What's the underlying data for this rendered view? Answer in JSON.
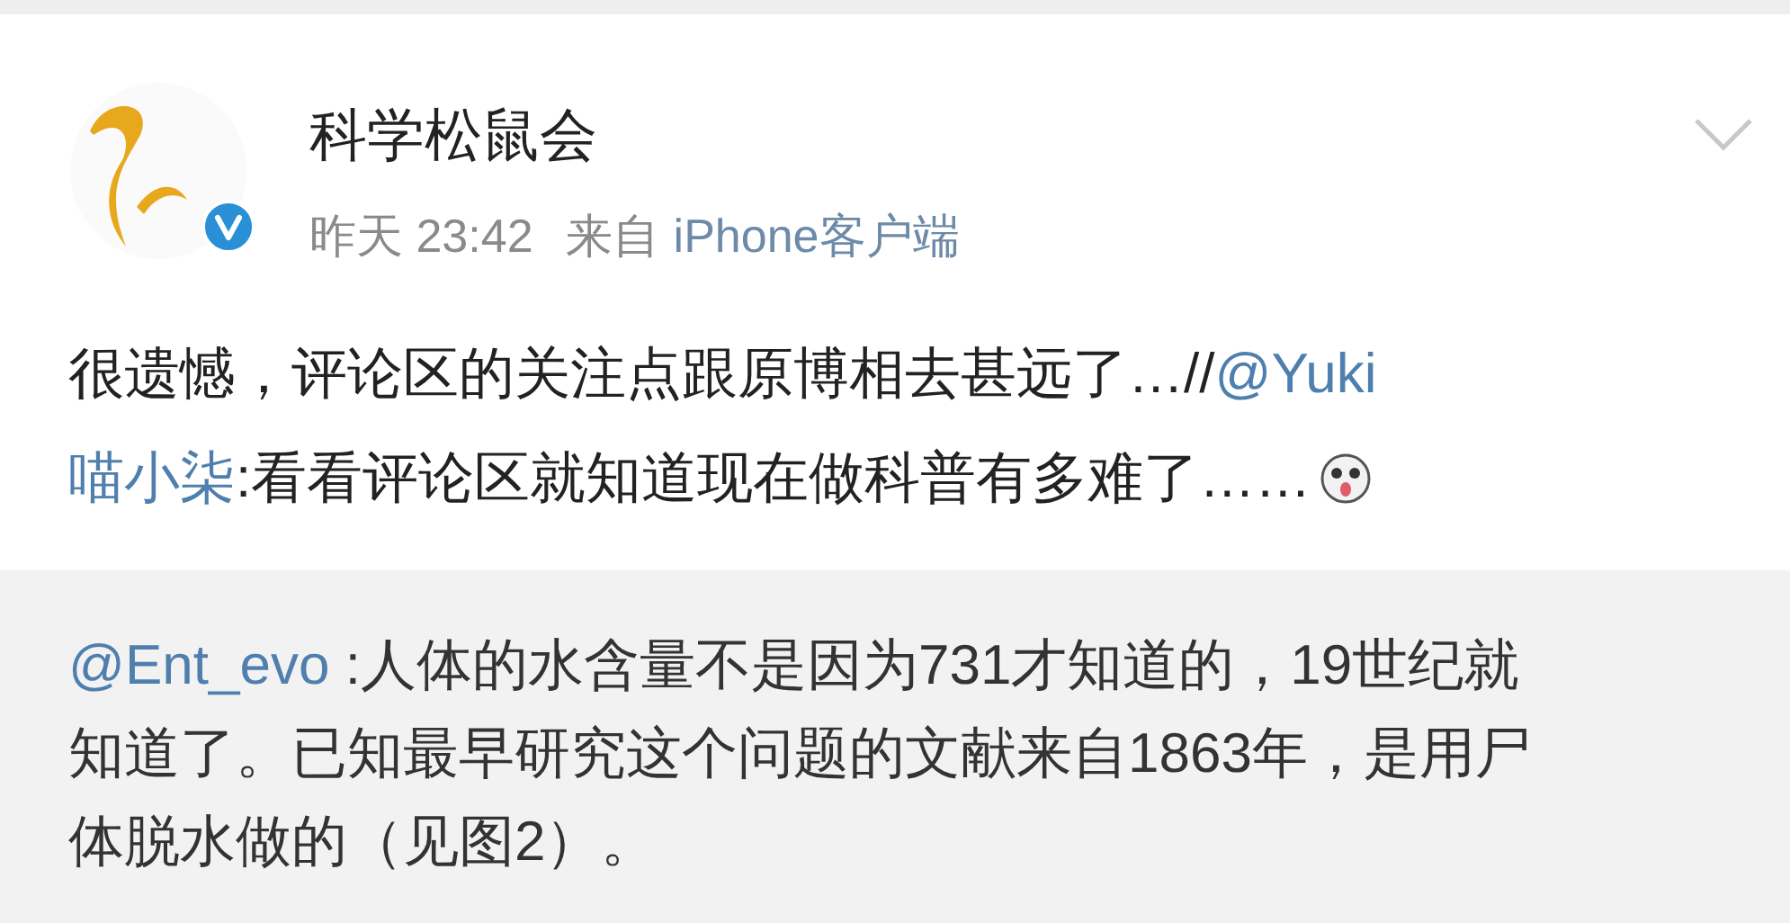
{
  "author": {
    "name": "科学松鼠会",
    "verified": true
  },
  "meta": {
    "time": "昨天 23:42",
    "source_label": "来自",
    "source": "iPhone客户端"
  },
  "post": {
    "lines": [
      [
        {
          "kind": "text",
          "text": "很遗憾，评论区的关注点跟原博相去甚远了…//"
        },
        {
          "kind": "mention",
          "text": "@Yuki"
        }
      ],
      [
        {
          "kind": "mention",
          "text": "喵小柒"
        },
        {
          "kind": "text",
          "text": ":看看评论区就知道现在做科普有多难了……"
        },
        {
          "kind": "emoji"
        }
      ]
    ]
  },
  "quoted": {
    "mention": "@Ent_evo",
    "text": " :人体的水含量不是因为731才知道的，19世纪就知道了。已知最早研究这个问题的文献来自1863年，是用尸体脱水做的（见图2）。"
  }
}
